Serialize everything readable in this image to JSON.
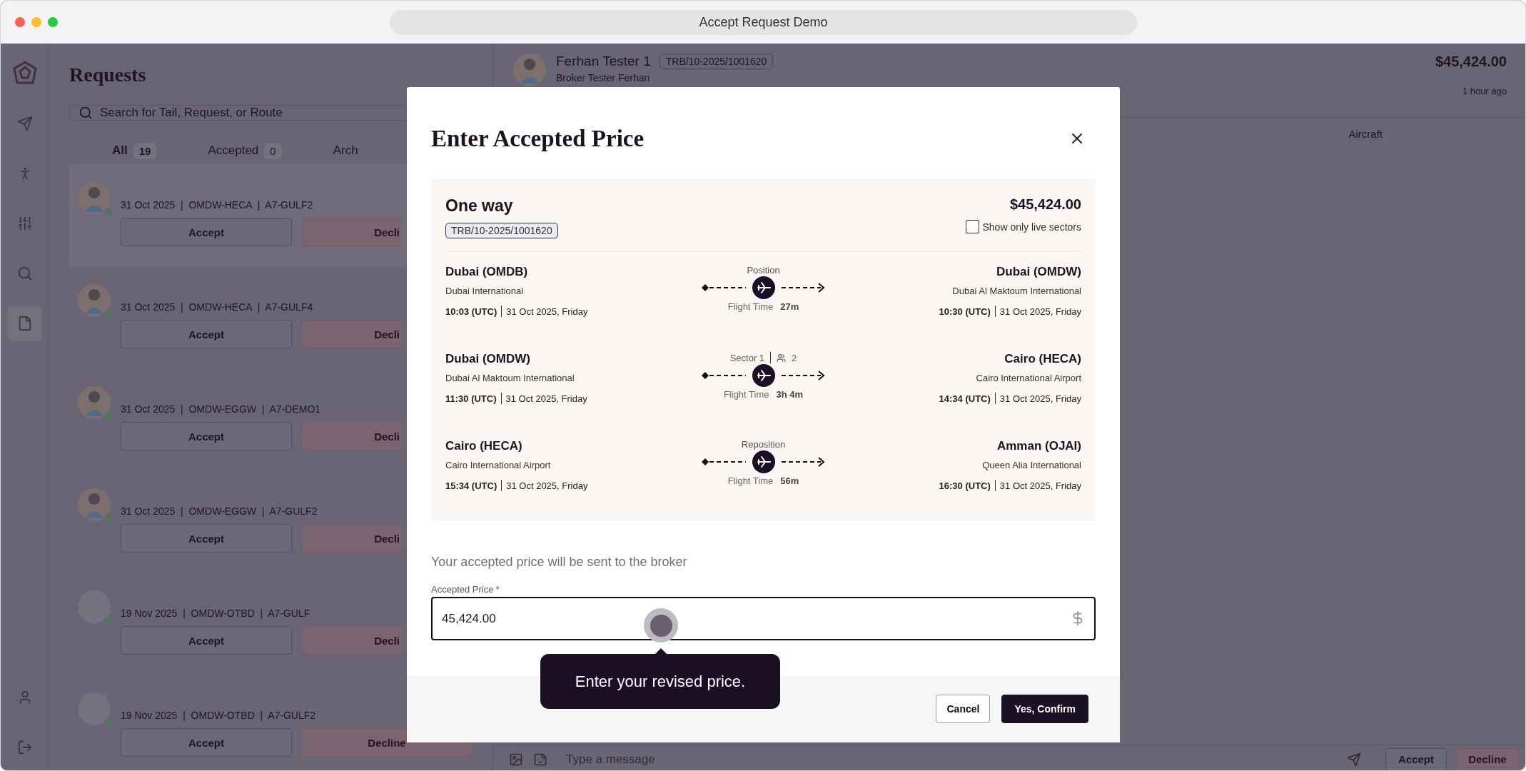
{
  "window": {
    "title": "Accept Request Demo"
  },
  "requests": {
    "title": "Requests",
    "search": {
      "placeholder": "Search for Tail, Request, or Route"
    },
    "tabs": [
      {
        "label": "All",
        "count": "19",
        "selected": true
      },
      {
        "label": "Accepted",
        "count": "0",
        "selected": false
      },
      {
        "label": "Arch",
        "selected": false
      }
    ],
    "cards": [
      {
        "kind": "figure",
        "selected": true,
        "meta": "31 Oct 2025  |  OMDW-HECA  |  A7-GULF2",
        "accept": "Accept",
        "decline": "Decli"
      },
      {
        "kind": "figure",
        "selected": false,
        "meta": "31 Oct 2025  |  OMDW-HECA  |  A7-GULF4",
        "accept": "Accept",
        "decline": "Decli"
      },
      {
        "kind": "figure",
        "selected": false,
        "meta": "31 Oct 2025  |  OMDW-EGGW  |  A7-DEMO1",
        "accept": "Accept",
        "decline": "Decli"
      },
      {
        "kind": "figure",
        "selected": false,
        "meta": "31 Oct 2025  |  OMDW-EGGW  |  A7-GULF2",
        "accept": "Accept",
        "decline": "Decli"
      },
      {
        "kind": "blank",
        "selected": false,
        "meta": "19 Nov 2025  |  OMDW-OTBD  |  A7-GULF",
        "accept": "Accept",
        "decline": "Decli"
      },
      {
        "kind": "blank",
        "selected": false,
        "meta": "19 Nov 2025  |  OMDW-OTBD  |  A7-GULF2",
        "accept": "Accept",
        "decline": "Decline"
      }
    ]
  },
  "detail": {
    "name": "Ferhan Tester 1",
    "reference": "TRB/10-2025/1001620",
    "subtitle": "Broker Tester Ferhan",
    "price": "$45,424.00",
    "time": "1 hour ago",
    "column": "Aircraft",
    "message": {
      "placeholder": "Type a message"
    },
    "accept": "Accept",
    "decline": "Decline"
  },
  "modal": {
    "title": "Enter Accepted Price",
    "trip": {
      "type": "One way",
      "price": "$45,424.00",
      "reference": "TRB/10-2025/1001620",
      "live_only": {
        "label": "Show only live sectors",
        "checked": false
      },
      "sectors": [
        {
          "label": "Position",
          "from": {
            "city": "Dubai (OMDB)",
            "airport": "Dubai International",
            "time": "10:03 (UTC)",
            "date": "31 Oct 2025, Friday"
          },
          "to": {
            "city": "Dubai (OMDW)",
            "airport": "Dubai Al Maktoum International",
            "time": "10:30 (UTC)",
            "date": "31 Oct 2025, Friday"
          },
          "flight_time_label": "Flight Time",
          "flight_time": "27m"
        },
        {
          "label": "Sector 1",
          "passengers": "2",
          "from": {
            "city": "Dubai (OMDW)",
            "airport": "Dubai Al Maktoum International",
            "time": "11:30 (UTC)",
            "date": "31 Oct 2025, Friday"
          },
          "to": {
            "city": "Cairo (HECA)",
            "airport": "Cairo International Airport",
            "time": "14:34 (UTC)",
            "date": "31 Oct 2025, Friday"
          },
          "flight_time_label": "Flight Time",
          "flight_time": "3h 4m"
        },
        {
          "label": "Reposition",
          "from": {
            "city": "Cairo (HECA)",
            "airport": "Cairo International Airport",
            "time": "15:34 (UTC)",
            "date": "31 Oct 2025, Friday"
          },
          "to": {
            "city": "Amman (OJAI)",
            "airport": "Queen Alia International",
            "time": "16:30 (UTC)",
            "date": "31 Oct 2025, Friday"
          },
          "flight_time_label": "Flight Time",
          "flight_time": "56m"
        }
      ]
    },
    "note": "Your accepted price will be sent to the broker",
    "field": {
      "label": "Accepted Price",
      "required_mark": "*",
      "value": "45,424.00"
    },
    "tooltip": "Enter your revised price.",
    "buttons": [
      {
        "label": "Cancel",
        "kind": "secondary"
      },
      {
        "label": "Yes, Confirm",
        "kind": "primary"
      }
    ]
  }
}
